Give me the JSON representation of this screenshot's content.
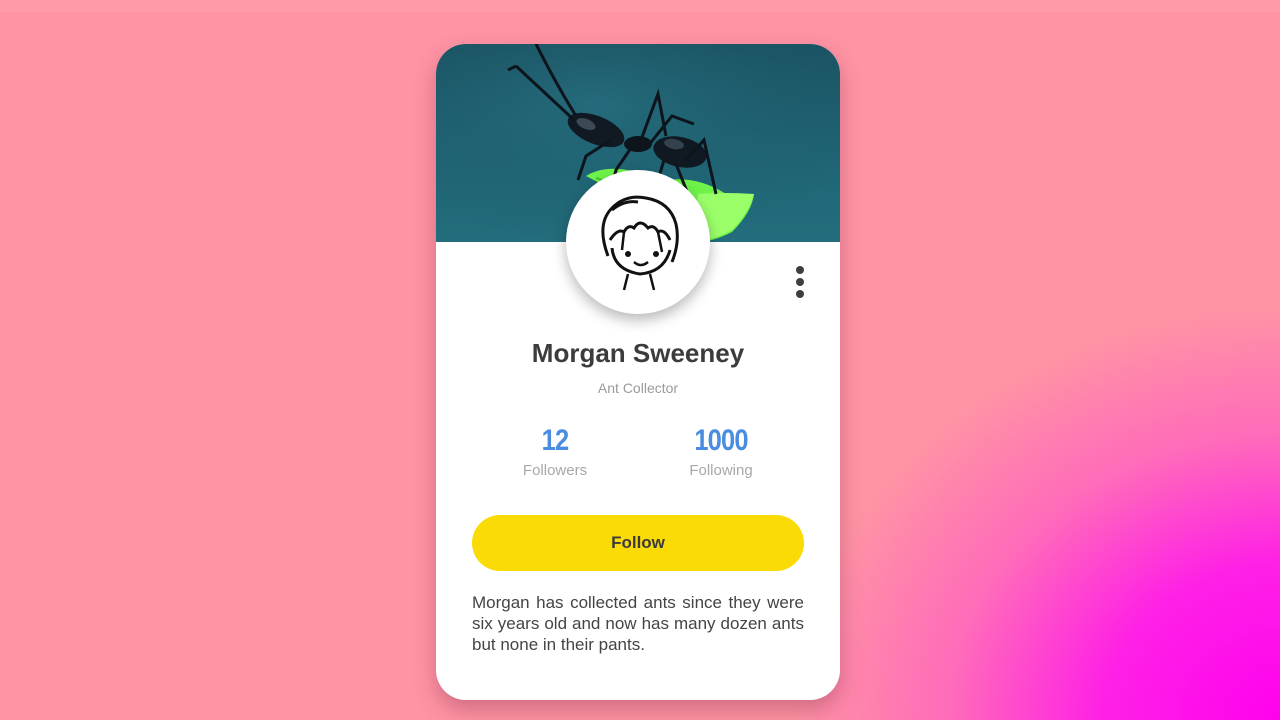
{
  "profile": {
    "name": "Morgan Sweeney",
    "role": "Ant Collector",
    "bio": "Morgan has collected ants since they were six years old and now has many dozen ants but none in their pants.",
    "followers": {
      "count": "12",
      "label": "Followers"
    },
    "following": {
      "count": "1000",
      "label": "Following"
    },
    "follow_button": "Follow",
    "menu_icon": "more-vertical-icon",
    "cover_image": "ant-on-leaf",
    "avatar_image": "cartoon-face"
  },
  "colors": {
    "background": "#ff94a4",
    "background_accent": "#ff00ee",
    "card": "#ffffff",
    "banner": "#1f6474",
    "accent_blue": "#4a8de0",
    "follow_button": "#fbdb05",
    "text_dark": "#3c3c3c",
    "text_muted": "#9a9a9a"
  }
}
